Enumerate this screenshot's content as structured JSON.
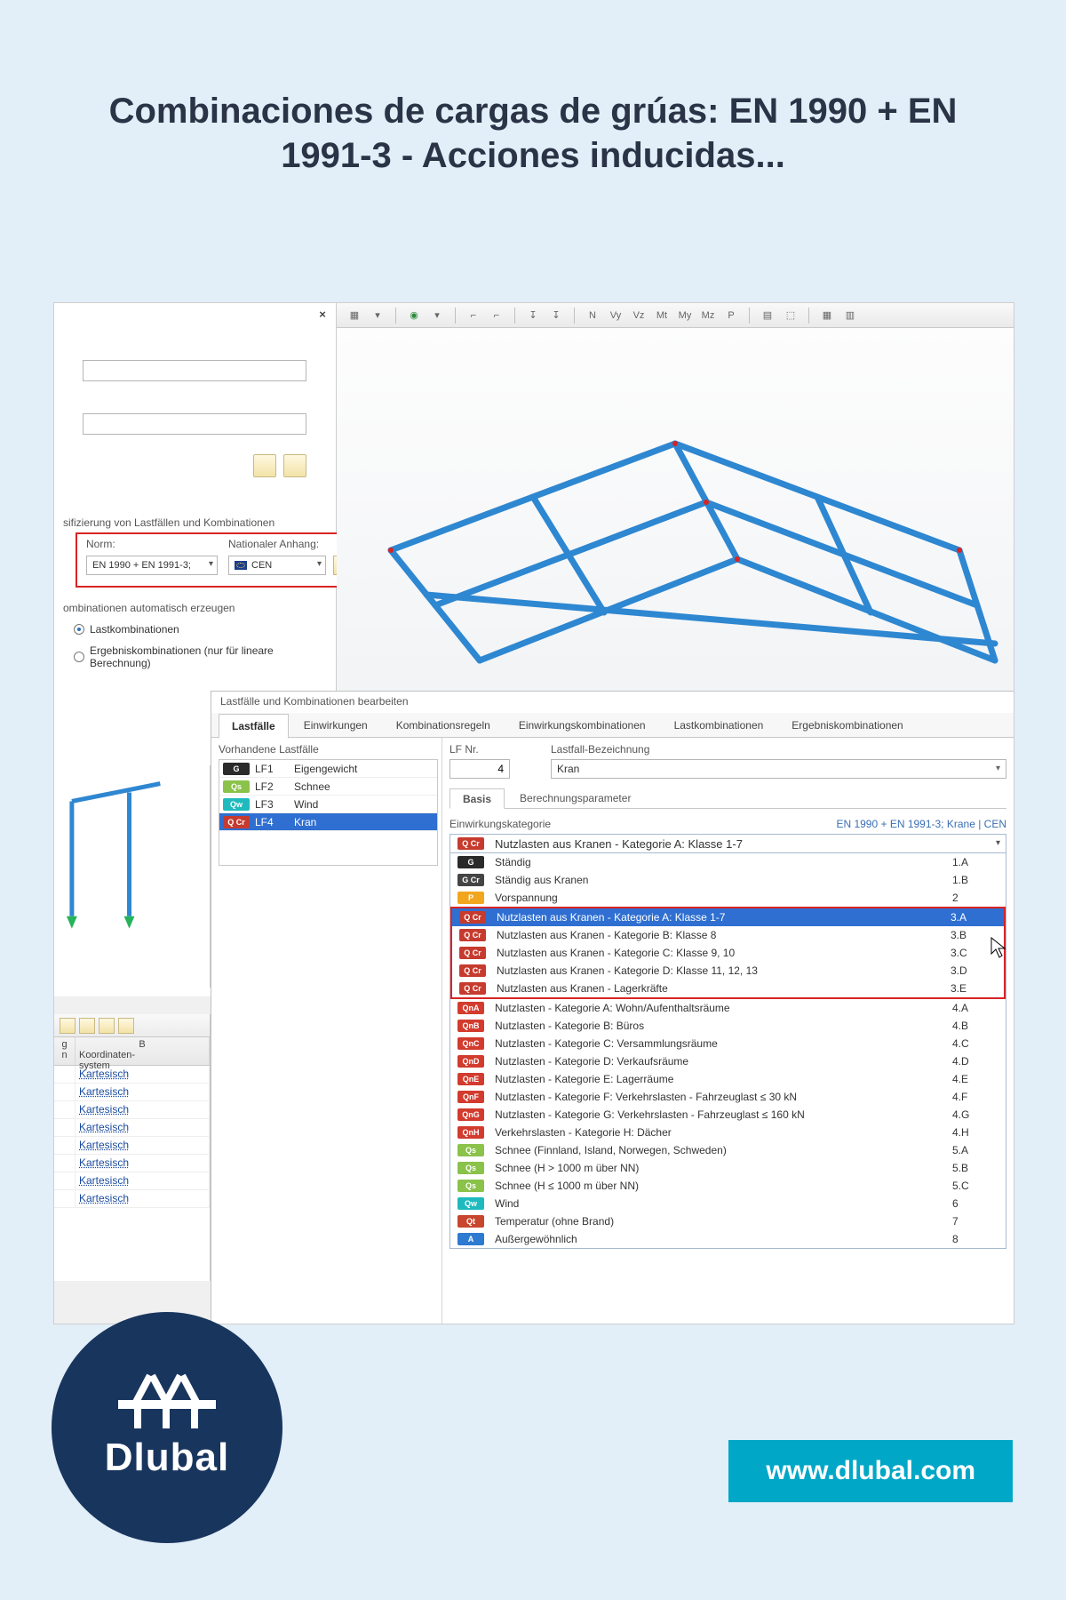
{
  "page": {
    "title": "Combinaciones de cargas de grúas: EN 1990 + EN 1991-3 - Acciones inducidas..."
  },
  "brand": {
    "name": "Dlubal",
    "url": "www.dlubal.com"
  },
  "left_panel": {
    "close": "×",
    "classify_header": "sifizierung von Lastfällen und Kombinationen",
    "norm_label": "Norm:",
    "norm_value": "EN 1990 + EN 1991-3;",
    "annex_label": "Nationaler Anhang:",
    "annex_value": "CEN",
    "auto_header": "ombinationen automatisch erzeugen",
    "radio1": "Lastkombinationen",
    "radio2": "Ergebniskombinationen (nur für lineare Berechnung)"
  },
  "dlg": {
    "title": "Lastfälle und Kombinationen bearbeiten",
    "tabs": [
      "Lastfälle",
      "Einwirkungen",
      "Kombinationsregeln",
      "Einwirkungskombinationen",
      "Lastkombinationen",
      "Ergebniskombinationen"
    ],
    "active_tab": 0,
    "vorhandene_header": "Vorhandene Lastfälle",
    "lf_rows": [
      {
        "badge": "G",
        "code": "LF1",
        "name": "Eigengewicht",
        "sel": false
      },
      {
        "badge": "Qs",
        "code": "LF2",
        "name": "Schnee",
        "sel": false
      },
      {
        "badge": "Qw",
        "code": "LF3",
        "name": "Wind",
        "sel": false
      },
      {
        "badge": "QCr",
        "code": "LF4",
        "name": "Kran",
        "sel": true
      }
    ],
    "lfnr_label": "LF Nr.",
    "lfnr_value": "4",
    "bez_label": "Lastfall-Bezeichnung",
    "bez_value": "Kran",
    "subtabs": [
      "Basis",
      "Berechnungsparameter"
    ],
    "subtab_active": 0,
    "cat_label": "Einwirkungskategorie",
    "cat_standard": "EN 1990 + EN 1991-3; Krane | CEN",
    "current_badge": "QCr",
    "current_text": "Nutzlasten aus Kranen - Kategorie A: Klasse 1-7",
    "dropdown_pre": [
      {
        "badge": "G",
        "txt": "Ständig",
        "code": "1.A"
      },
      {
        "badge": "GCr",
        "txt": "Ständig aus Kranen",
        "code": "1.B"
      },
      {
        "badge": "P",
        "txt": "Vorspannung",
        "code": "2"
      }
    ],
    "dropdown_frame": [
      {
        "badge": "QCr",
        "txt": "Nutzlasten aus Kranen - Kategorie A: Klasse 1-7",
        "code": "3.A",
        "hl": true
      },
      {
        "badge": "QCr",
        "txt": "Nutzlasten aus Kranen - Kategorie B: Klasse 8",
        "code": "3.B"
      },
      {
        "badge": "QCr",
        "txt": "Nutzlasten aus Kranen - Kategorie C: Klasse 9, 10",
        "code": "3.C"
      },
      {
        "badge": "QCr",
        "txt": "Nutzlasten aus Kranen - Kategorie D: Klasse 11, 12, 13",
        "code": "3.D"
      },
      {
        "badge": "QCr",
        "txt": "Nutzlasten aus Kranen - Lagerkräfte",
        "code": "3.E"
      }
    ],
    "dropdown_post": [
      {
        "badge": "QnA",
        "txt": "Nutzlasten - Kategorie A: Wohn/Aufenthaltsräume",
        "code": "4.A"
      },
      {
        "badge": "QnB",
        "txt": "Nutzlasten - Kategorie B: Büros",
        "code": "4.B"
      },
      {
        "badge": "QnC",
        "txt": "Nutzlasten - Kategorie C: Versammlungsräume",
        "code": "4.C"
      },
      {
        "badge": "QnD",
        "txt": "Nutzlasten - Kategorie D: Verkaufsräume",
        "code": "4.D"
      },
      {
        "badge": "QnE",
        "txt": "Nutzlasten - Kategorie E: Lagerräume",
        "code": "4.E"
      },
      {
        "badge": "QnF",
        "txt": "Nutzlasten - Kategorie F: Verkehrslasten - Fahrzeuglast ≤ 30 kN",
        "code": "4.F"
      },
      {
        "badge": "QnG",
        "txt": "Nutzlasten - Kategorie G: Verkehrslasten - Fahrzeuglast ≤ 160 kN",
        "code": "4.G"
      },
      {
        "badge": "QnH",
        "txt": "Verkehrslasten - Kategorie H: Dächer",
        "code": "4.H"
      },
      {
        "badge": "Qs",
        "txt": "Schnee (Finnland, Island, Norwegen, Schweden)",
        "code": "5.A"
      },
      {
        "badge": "Qs",
        "txt": "Schnee (H > 1000 m über NN)",
        "code": "5.B"
      },
      {
        "badge": "Qs",
        "txt": "Schnee (H ≤ 1000 m über NN)",
        "code": "5.C"
      },
      {
        "badge": "Qw",
        "txt": "Wind",
        "code": "6"
      },
      {
        "badge": "Qt",
        "txt": "Temperatur (ohne Brand)",
        "code": "7"
      },
      {
        "badge": "A",
        "txt": "Außergewöhnlich",
        "code": "8"
      }
    ]
  },
  "bl_table": {
    "header_A": "B",
    "header_B_line1": "Koordinaten-",
    "header_B_line2": "system",
    "left_hdr_line1": "g",
    "left_hdr_line2": "n",
    "rows": [
      "Kartesisch",
      "Kartesisch",
      "Kartesisch",
      "Kartesisch",
      "Kartesisch",
      "Kartesisch",
      "Kartesisch",
      "Kartesisch"
    ]
  }
}
